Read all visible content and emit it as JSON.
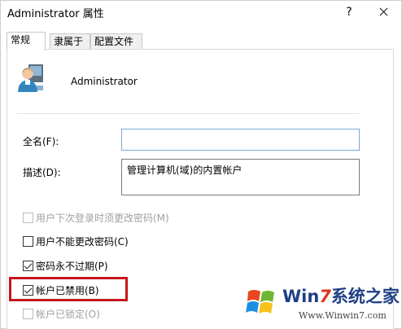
{
  "window": {
    "title": "Administrator 属性",
    "help_glyph": "?"
  },
  "tabs": [
    {
      "label": "常规",
      "active": true
    },
    {
      "label": "隶属于",
      "active": false
    },
    {
      "label": "配置文件",
      "active": false
    }
  ],
  "general": {
    "username": "Administrator",
    "fullname_label": "全名(F):",
    "fullname_value": "",
    "description_label": "描述(D):",
    "description_value": "管理计算机(域)的内置帐户"
  },
  "options": {
    "must_change": {
      "label": "用户下次登录时须更改密码(M)",
      "checked": false,
      "enabled": false
    },
    "cannot_change": {
      "label": "用户不能更改密码(C)",
      "checked": false,
      "enabled": true
    },
    "never_expires": {
      "label": "密码永不过期(P)",
      "checked": true,
      "enabled": true
    },
    "account_disabled": {
      "label": "帐户已禁用(B)",
      "checked": true,
      "enabled": true
    },
    "account_locked": {
      "label": "帐户已锁定(O)",
      "checked": false,
      "enabled": false
    }
  },
  "watermark": {
    "brand_prefix": "Win",
    "brand_seven": "7",
    "brand_suffix": "系统之家",
    "url": "Www.Winwin7.com"
  },
  "colors": {
    "highlight": "#c4161c",
    "input_focus_border": "#7aa8d9",
    "watermark_blue": "#1f3f84",
    "watermark_red": "#e0321c"
  },
  "icons": {
    "user": "user-account-icon",
    "close": "close-icon",
    "help": "help-icon",
    "logo": "windows-logo-icon"
  }
}
